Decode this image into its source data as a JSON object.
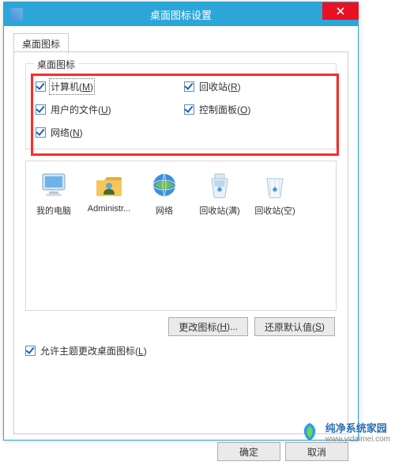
{
  "titlebar": {
    "title": "桌面图标设置"
  },
  "tab": {
    "label": "桌面图标"
  },
  "fieldset": {
    "legend": "桌面图标"
  },
  "checks": {
    "computer": {
      "label_pre": "计算机(",
      "key": "M",
      "label_post": ")"
    },
    "recycle": {
      "label_pre": "回收站(",
      "key": "R",
      "label_post": ")"
    },
    "userdocs": {
      "label_pre": "用户的文件(",
      "key": "U",
      "label_post": ")"
    },
    "cpanel": {
      "label_pre": "控制面板(",
      "key": "O",
      "label_post": ")"
    },
    "network": {
      "label_pre": "网络(",
      "key": "N",
      "label_post": ")"
    }
  },
  "icons": {
    "mypc": "我的电脑",
    "admin": "Administr...",
    "net": "网络",
    "bin_full": "回收站(满)",
    "bin_empty": "回收站(空)"
  },
  "buttons": {
    "change_icon_pre": "更改图标(",
    "change_icon_key": "H",
    "change_icon_post": ")...",
    "restore_pre": "还原默认值(",
    "restore_key": "S",
    "restore_post": ")",
    "ok": "确定",
    "cancel": "取消"
  },
  "allow_theme": {
    "pre": "允许主题更改桌面图标(",
    "key": "L",
    "post": ")"
  },
  "watermark": {
    "brand": "纯净系统家园",
    "url": "www.yidaimei.com"
  }
}
